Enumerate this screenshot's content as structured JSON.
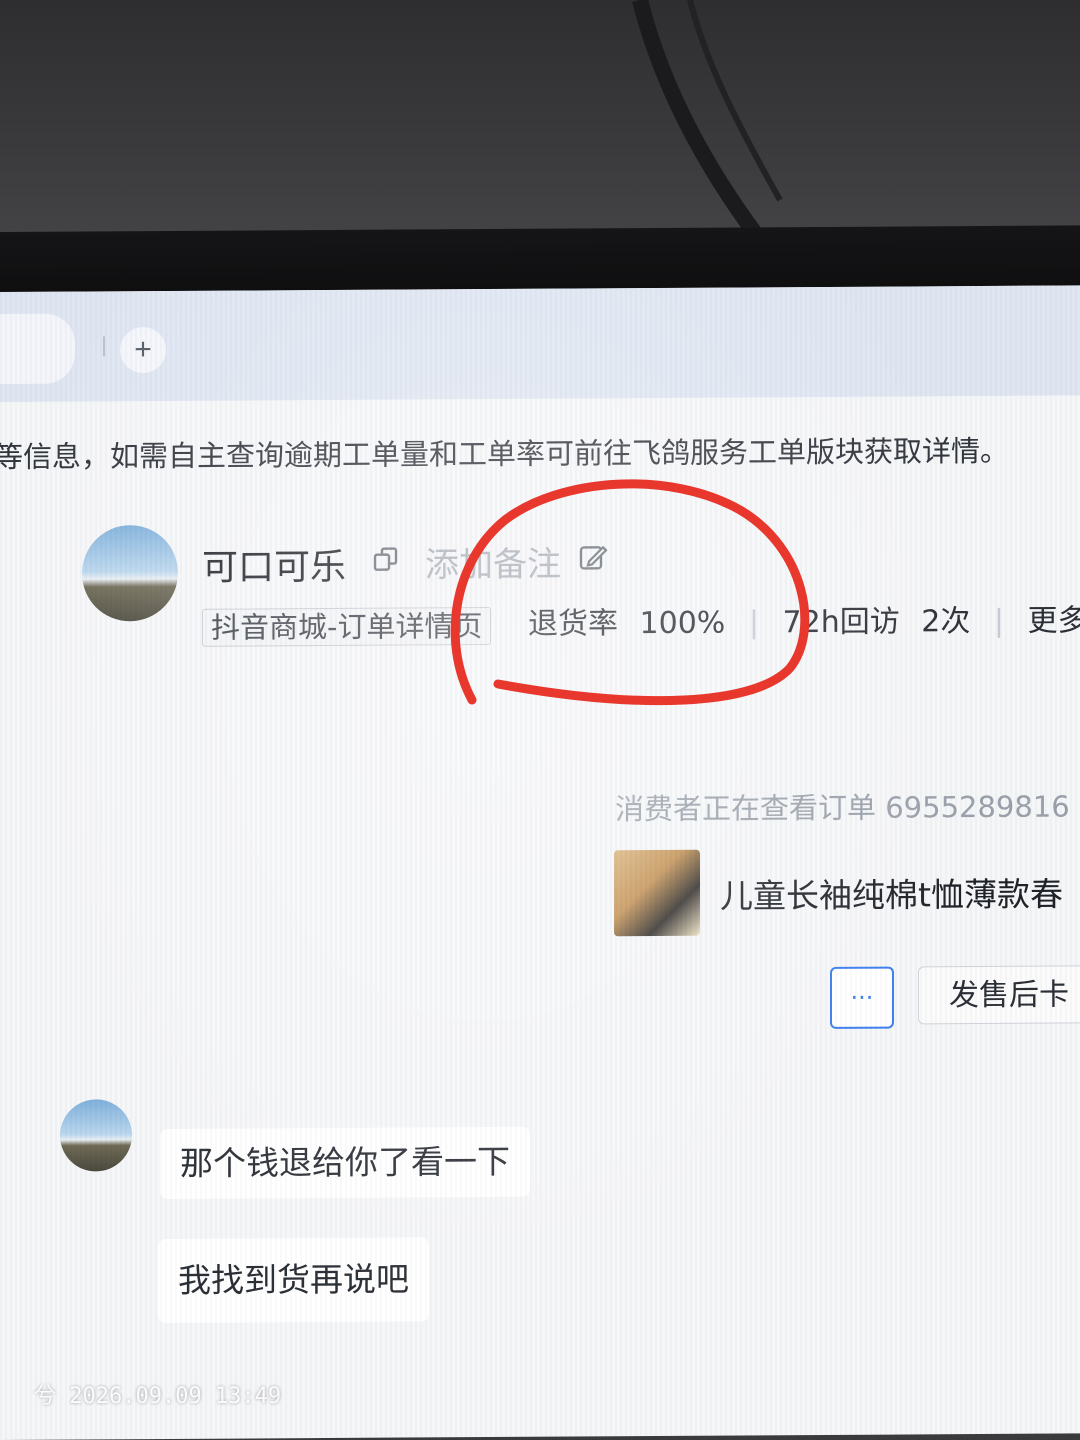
{
  "browser": {
    "new_tab_glyph": "+"
  },
  "notice": {
    "text": "等信息，如需自主查询逾期工单量和工单率可前往飞鸽服务工单版块获取详情。"
  },
  "customer": {
    "name": "可口可乐",
    "remark_label": "添加备注",
    "source_tag": "抖音商城-订单详情页",
    "return_rate_label": "退货率",
    "return_rate_value": "100%",
    "visit_text": "72h回访",
    "visit_count": "2次",
    "more_label": "更多"
  },
  "order": {
    "hint": "消费者正在查看订单 6955289816",
    "product_title": "儿童长袖纯棉t恤薄款春",
    "more_glyph": "···",
    "aftersale_label": "发售后卡"
  },
  "messages": [
    {
      "text": "那个钱退给你了看一下"
    },
    {
      "text": "我找到货再说吧"
    }
  ],
  "photo": {
    "timestamp": "兮 2026.09.09 13:49"
  },
  "annotation": {
    "color": "#e8382e"
  }
}
